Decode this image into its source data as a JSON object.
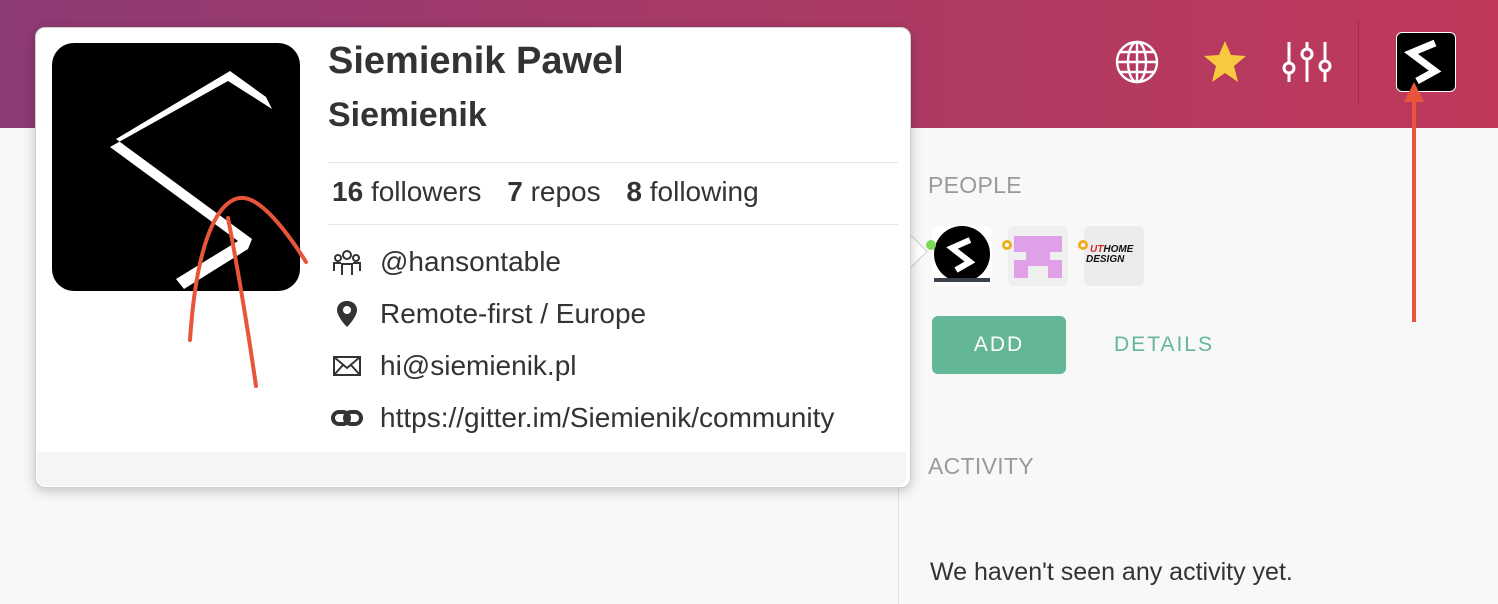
{
  "header": {
    "icons": [
      "globe-icon",
      "star-icon",
      "settings-sliders-icon"
    ],
    "star_color": "#f8c93e"
  },
  "profile": {
    "display_name": "Siemienik Pawel",
    "username": "Siemienik",
    "stats": [
      {
        "count": "16",
        "label": "followers"
      },
      {
        "count": "7",
        "label": "repos"
      },
      {
        "count": "8",
        "label": "following"
      }
    ],
    "info": {
      "company": "@hansontable",
      "location": "Remote-first / Europe",
      "email": "hi@siemienik.pl",
      "website": "https://gitter.im/Siemienik/community"
    }
  },
  "sidebar": {
    "people_title": "PEOPLE",
    "add_label": "ADD",
    "details_label": "DETAILS",
    "activity_title": "ACTIVITY",
    "activity_empty": "We haven't seen any activity yet.",
    "people": [
      {
        "status": "online"
      },
      {
        "status": "away"
      },
      {
        "status": "away",
        "logo_text": "UT HOME DESIGN"
      }
    ]
  },
  "colors": {
    "accent": "#63b797",
    "online": "#7ed957",
    "away": "#f0ad1e",
    "annotation": "#e8553a"
  }
}
